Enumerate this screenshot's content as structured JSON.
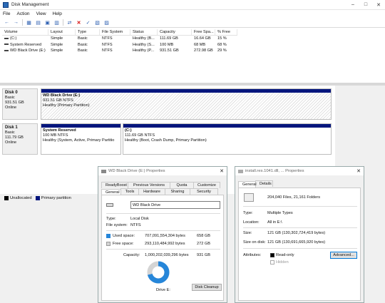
{
  "window": {
    "title": "Disk Management",
    "controls": [
      "–",
      "□",
      "✕"
    ]
  },
  "menu": [
    "File",
    "Action",
    "View",
    "Help"
  ],
  "volumes": {
    "headers": [
      "Volume",
      "Layout",
      "Type",
      "File System",
      "Status",
      "Capacity",
      "Free Spa...",
      "% Free"
    ],
    "rows": [
      [
        "(C:)",
        "Simple",
        "Basic",
        "NTFS",
        "Healthy (B...",
        "111.69 GB",
        "16.64 GB",
        "15 %"
      ],
      [
        "System Reserved",
        "Simple",
        "Basic",
        "NTFS",
        "Healthy (S...",
        "100 MB",
        "68 MB",
        "68 %"
      ],
      [
        "WD Black Drive (E:)",
        "Simple",
        "Basic",
        "NTFS",
        "Healthy (P...",
        "931.51 GB",
        "272.98 GB",
        "29 %"
      ]
    ]
  },
  "disk0": {
    "name": "Disk 0",
    "type": "Basic",
    "size": "931.51 GB",
    "status": "Online",
    "partition": {
      "name": "WD Black Drive  (E:)",
      "size": "931.51 GB NTFS",
      "status": "Healthy (Primary Partition)"
    }
  },
  "disk1": {
    "name": "Disk 1",
    "type": "Basic",
    "size": "111.79 GB",
    "status": "Online",
    "p1": {
      "name": "System Reserved",
      "size": "100 MB NTFS",
      "status": "Healthy (System, Active, Primary Partitio"
    },
    "p2": {
      "name": "(C:)",
      "size": "111.69 GB NTFS",
      "status": "Healthy (Boot, Crash Dump, Primary Partition)"
    }
  },
  "legend": {
    "unallocated": "Unallocated",
    "primary": "Primary partition"
  },
  "colors": {
    "primary_partition": "#04167d",
    "used_space": "#2686d9",
    "free_space": "#d4d4d4"
  },
  "props": {
    "title": "WD Black Drive (E:) Properties",
    "tabs_top": [
      "ReadyBoost",
      "Previous Versions",
      "Quota",
      "Customize"
    ],
    "tabs_bottom": [
      "General",
      "Tools",
      "Hardware",
      "Sharing",
      "Security"
    ],
    "name_value": "WD Black Drive",
    "type_label": "Type:",
    "type_value": "Local Disk",
    "fs_label": "File system:",
    "fs_value": "NTFS",
    "used_label": "Used space:",
    "used_bytes": "707,091,554,304 bytes",
    "used_gb": "658 GB",
    "free_label": "Free space:",
    "free_bytes": "293,110,484,992 bytes",
    "free_gb": "272 GB",
    "cap_label": "Capacity:",
    "cap_bytes": "1,000,202,039,296 bytes",
    "cap_gb": "931 GB",
    "used_fraction": 0.707,
    "drive_label": "Drive E:",
    "cleanup_button": "Disk Cleanup"
  },
  "fprops": {
    "title": "install.res.1041.dll, ... Properties",
    "tabs": [
      "General",
      "Details"
    ],
    "summary": "204,040 Files, 21,161 Folders",
    "type_label": "Type:",
    "type_value": "Multiple Types",
    "location_label": "Location:",
    "location_value": "All in E:\\",
    "size_label": "Size:",
    "size_value": "121 GB (130,302,724,419 bytes)",
    "sod_label": "Size on disk:",
    "sod_value": "121 GB (130,691,665,920 bytes)",
    "attr_label": "Attributes:",
    "readonly_label": "Read-only",
    "hidden_label": "Hidden",
    "advanced_button": "Advanced..."
  }
}
